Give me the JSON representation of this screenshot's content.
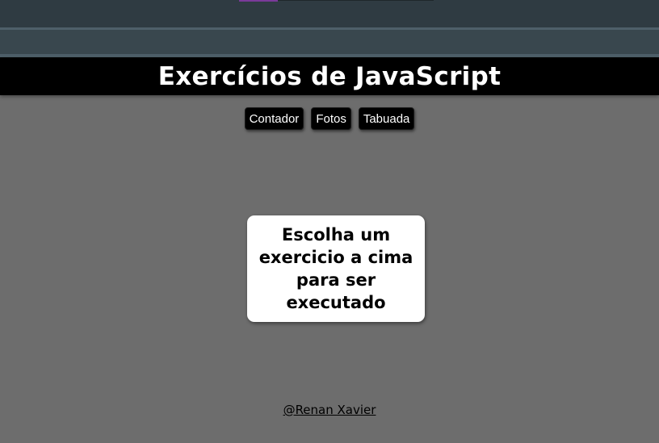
{
  "header": {
    "title": "Exercícios de JavaScript"
  },
  "nav": {
    "items": [
      {
        "label": "Contador"
      },
      {
        "label": "Fotos"
      },
      {
        "label": "Tabuada"
      }
    ]
  },
  "main": {
    "message": "Escolha um exercicio a cima para ser executado"
  },
  "footer": {
    "credit": "@Renan Xavier"
  },
  "colors": {
    "background": "#6d6d6d",
    "header_bg": "#000000",
    "browser_chrome": "#2f3b42",
    "card_bg": "#ffffff"
  }
}
